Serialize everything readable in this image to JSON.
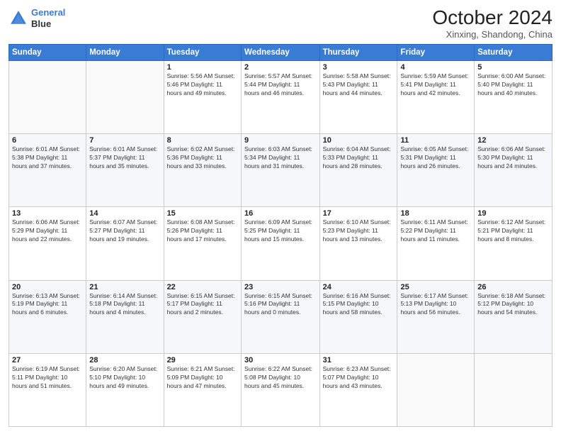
{
  "header": {
    "logo_line1": "General",
    "logo_line2": "Blue",
    "month": "October 2024",
    "location": "Xinxing, Shandong, China"
  },
  "days_of_week": [
    "Sunday",
    "Monday",
    "Tuesday",
    "Wednesday",
    "Thursday",
    "Friday",
    "Saturday"
  ],
  "weeks": [
    [
      {
        "day": "",
        "info": ""
      },
      {
        "day": "",
        "info": ""
      },
      {
        "day": "1",
        "info": "Sunrise: 5:56 AM\nSunset: 5:46 PM\nDaylight: 11 hours and 49 minutes."
      },
      {
        "day": "2",
        "info": "Sunrise: 5:57 AM\nSunset: 5:44 PM\nDaylight: 11 hours and 46 minutes."
      },
      {
        "day": "3",
        "info": "Sunrise: 5:58 AM\nSunset: 5:43 PM\nDaylight: 11 hours and 44 minutes."
      },
      {
        "day": "4",
        "info": "Sunrise: 5:59 AM\nSunset: 5:41 PM\nDaylight: 11 hours and 42 minutes."
      },
      {
        "day": "5",
        "info": "Sunrise: 6:00 AM\nSunset: 5:40 PM\nDaylight: 11 hours and 40 minutes."
      }
    ],
    [
      {
        "day": "6",
        "info": "Sunrise: 6:01 AM\nSunset: 5:38 PM\nDaylight: 11 hours and 37 minutes."
      },
      {
        "day": "7",
        "info": "Sunrise: 6:01 AM\nSunset: 5:37 PM\nDaylight: 11 hours and 35 minutes."
      },
      {
        "day": "8",
        "info": "Sunrise: 6:02 AM\nSunset: 5:36 PM\nDaylight: 11 hours and 33 minutes."
      },
      {
        "day": "9",
        "info": "Sunrise: 6:03 AM\nSunset: 5:34 PM\nDaylight: 11 hours and 31 minutes."
      },
      {
        "day": "10",
        "info": "Sunrise: 6:04 AM\nSunset: 5:33 PM\nDaylight: 11 hours and 28 minutes."
      },
      {
        "day": "11",
        "info": "Sunrise: 6:05 AM\nSunset: 5:31 PM\nDaylight: 11 hours and 26 minutes."
      },
      {
        "day": "12",
        "info": "Sunrise: 6:06 AM\nSunset: 5:30 PM\nDaylight: 11 hours and 24 minutes."
      }
    ],
    [
      {
        "day": "13",
        "info": "Sunrise: 6:06 AM\nSunset: 5:29 PM\nDaylight: 11 hours and 22 minutes."
      },
      {
        "day": "14",
        "info": "Sunrise: 6:07 AM\nSunset: 5:27 PM\nDaylight: 11 hours and 19 minutes."
      },
      {
        "day": "15",
        "info": "Sunrise: 6:08 AM\nSunset: 5:26 PM\nDaylight: 11 hours and 17 minutes."
      },
      {
        "day": "16",
        "info": "Sunrise: 6:09 AM\nSunset: 5:25 PM\nDaylight: 11 hours and 15 minutes."
      },
      {
        "day": "17",
        "info": "Sunrise: 6:10 AM\nSunset: 5:23 PM\nDaylight: 11 hours and 13 minutes."
      },
      {
        "day": "18",
        "info": "Sunrise: 6:11 AM\nSunset: 5:22 PM\nDaylight: 11 hours and 11 minutes."
      },
      {
        "day": "19",
        "info": "Sunrise: 6:12 AM\nSunset: 5:21 PM\nDaylight: 11 hours and 8 minutes."
      }
    ],
    [
      {
        "day": "20",
        "info": "Sunrise: 6:13 AM\nSunset: 5:19 PM\nDaylight: 11 hours and 6 minutes."
      },
      {
        "day": "21",
        "info": "Sunrise: 6:14 AM\nSunset: 5:18 PM\nDaylight: 11 hours and 4 minutes."
      },
      {
        "day": "22",
        "info": "Sunrise: 6:15 AM\nSunset: 5:17 PM\nDaylight: 11 hours and 2 minutes."
      },
      {
        "day": "23",
        "info": "Sunrise: 6:15 AM\nSunset: 5:16 PM\nDaylight: 11 hours and 0 minutes."
      },
      {
        "day": "24",
        "info": "Sunrise: 6:16 AM\nSunset: 5:15 PM\nDaylight: 10 hours and 58 minutes."
      },
      {
        "day": "25",
        "info": "Sunrise: 6:17 AM\nSunset: 5:13 PM\nDaylight: 10 hours and 56 minutes."
      },
      {
        "day": "26",
        "info": "Sunrise: 6:18 AM\nSunset: 5:12 PM\nDaylight: 10 hours and 54 minutes."
      }
    ],
    [
      {
        "day": "27",
        "info": "Sunrise: 6:19 AM\nSunset: 5:11 PM\nDaylight: 10 hours and 51 minutes."
      },
      {
        "day": "28",
        "info": "Sunrise: 6:20 AM\nSunset: 5:10 PM\nDaylight: 10 hours and 49 minutes."
      },
      {
        "day": "29",
        "info": "Sunrise: 6:21 AM\nSunset: 5:09 PM\nDaylight: 10 hours and 47 minutes."
      },
      {
        "day": "30",
        "info": "Sunrise: 6:22 AM\nSunset: 5:08 PM\nDaylight: 10 hours and 45 minutes."
      },
      {
        "day": "31",
        "info": "Sunrise: 6:23 AM\nSunset: 5:07 PM\nDaylight: 10 hours and 43 minutes."
      },
      {
        "day": "",
        "info": ""
      },
      {
        "day": "",
        "info": ""
      }
    ]
  ]
}
